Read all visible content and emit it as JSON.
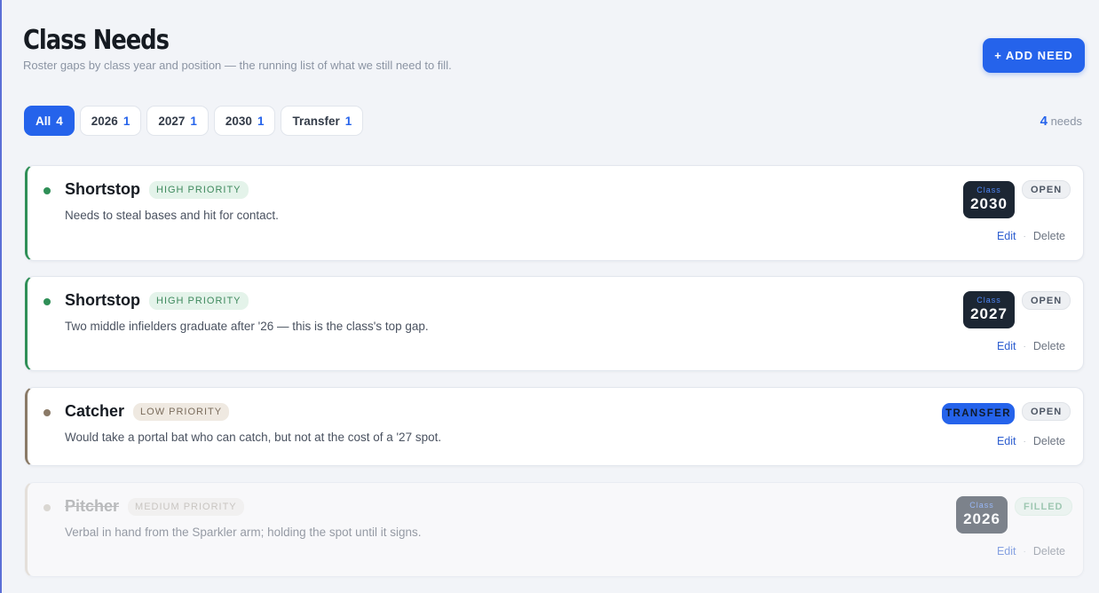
{
  "header": {
    "title": "Class Needs",
    "subtitle": "Roster gaps by class year and position — the running list of what we still need to fill.",
    "add_label": "+ ADD NEED"
  },
  "filters": [
    {
      "label": "All",
      "count": "4",
      "active": true
    },
    {
      "label": "2026",
      "count": "1"
    },
    {
      "label": "2027",
      "count": "1"
    },
    {
      "label": "2030",
      "count": "1"
    },
    {
      "label": "Transfer",
      "count": "1"
    }
  ],
  "summary": {
    "count": "4",
    "label": "needs"
  },
  "needs": [
    {
      "position": "Shortstop",
      "priority": "HIGH PRIORITY",
      "description": "Needs to steal bases and hit for contact.",
      "class_label": "Class",
      "class_year": "2030",
      "status": "OPEN",
      "edit": "Edit",
      "sep": "·",
      "delete": "Delete"
    },
    {
      "position": "Shortstop",
      "priority": "HIGH PRIORITY",
      "description": "Two middle infielders graduate after '26 — this is the class's top gap.",
      "class_label": "Class",
      "class_year": "2027",
      "status": "OPEN",
      "edit": "Edit",
      "sep": "·",
      "delete": "Delete"
    },
    {
      "position": "Catcher",
      "priority": "LOW PRIORITY",
      "description": "Would take a portal bat who can catch, but not at the cost of a '27 spot.",
      "badge": "TRANSFER",
      "status": "OPEN",
      "edit": "Edit",
      "sep": "·",
      "delete": "Delete"
    },
    {
      "position": "Pitcher",
      "priority": "MEDIUM PRIORITY",
      "description": "Verbal in hand from the Sparkler arm; holding the spot until it signs.",
      "class_label": "Class",
      "class_year": "2026",
      "status": "FILLED",
      "edit": "Edit",
      "sep": "·",
      "delete": "Delete"
    }
  ],
  "colors": {
    "accent": "#2563eb",
    "high": "#2f8f57",
    "low": "#8a7a67",
    "dark_badge": "#1c2633"
  }
}
